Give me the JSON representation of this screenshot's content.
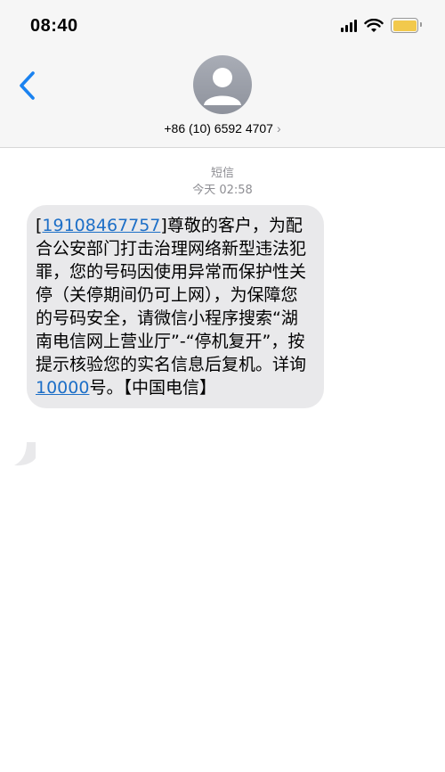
{
  "status_bar": {
    "time": "08:40"
  },
  "header": {
    "contact": "+86 (10) 6592 4707",
    "chevron": "›"
  },
  "thread": {
    "label": "短信",
    "timestamp": "今天 02:58"
  },
  "message": {
    "open_bracket": "[",
    "phone": "19108467757",
    "after_phone": "]尊敬的客户，为配合公安部门打击治理网络新型违法犯罪，您的号码因使用异常而保护性关停（关停期间仍可上网），为保障您的号码安全，请微信小程序搜索“湖南电信网上营业厅”-“停机复开”，按提示核验您的实名信息后复机。详询",
    "service_number": "10000",
    "after_service": "号。【中国电信】"
  },
  "colors": {
    "bubble": "#e9e9eb",
    "link": "#1d6fc7",
    "back_chevron": "#1a82f0",
    "battery": "#f2c94c"
  },
  "icons": [
    "back-chevron-icon",
    "avatar-person-icon",
    "signal-icon",
    "wifi-icon",
    "battery-icon"
  ]
}
